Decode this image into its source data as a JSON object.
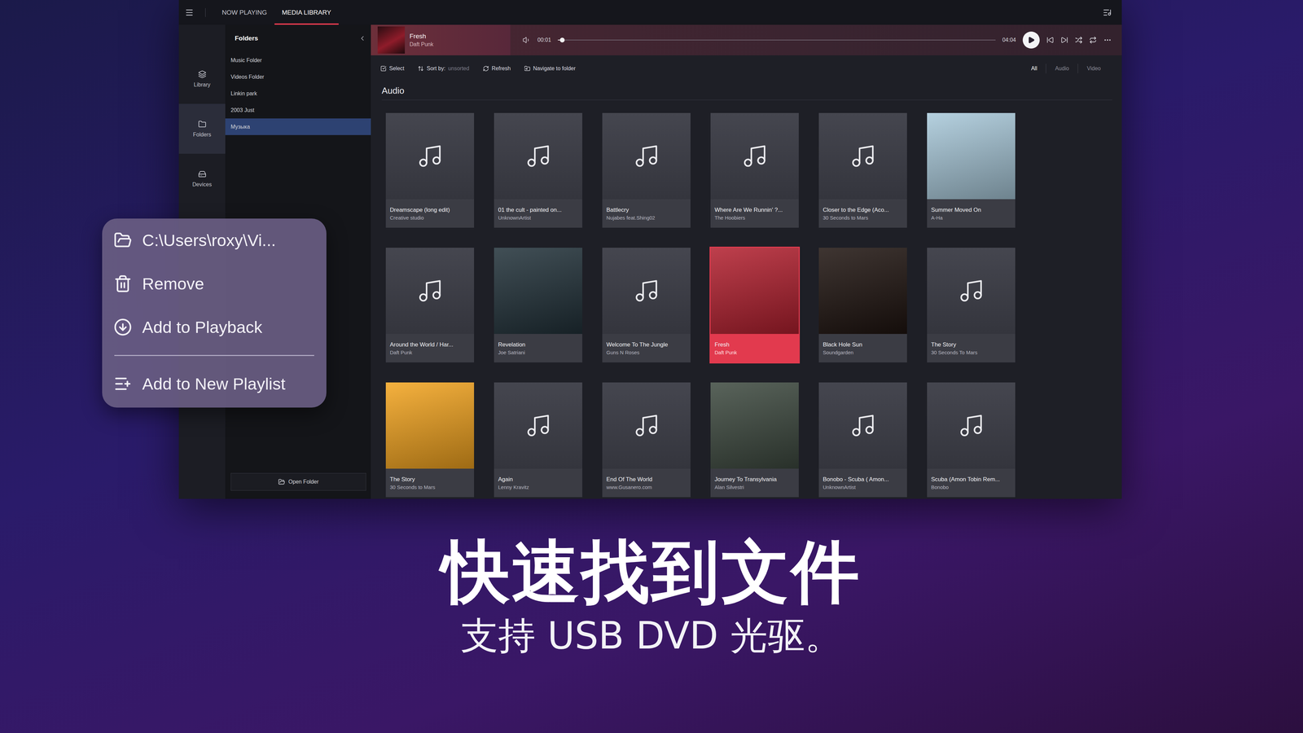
{
  "window": {
    "tabs": [
      {
        "label": "NOW PLAYING",
        "selected": false
      },
      {
        "label": "MEDIA LIBRARY",
        "selected": true
      }
    ]
  },
  "rail": [
    {
      "label": "Library",
      "kind": "library",
      "selected": false
    },
    {
      "label": "Folders",
      "kind": "folders",
      "selected": true
    },
    {
      "label": "Devices",
      "kind": "devices",
      "selected": false
    }
  ],
  "folders_panel": {
    "title": "Folders",
    "items": [
      {
        "label": "Music Folder",
        "selected": false
      },
      {
        "label": "Videos Folder",
        "selected": false
      },
      {
        "label": "Linkin park",
        "selected": false
      },
      {
        "label": "2003 Just",
        "selected": false
      },
      {
        "label": "Музыка",
        "selected": true
      }
    ],
    "button": "Open Folder"
  },
  "player": {
    "title": "Fresh",
    "artist": "Daft Punk",
    "elapsed": "00:01",
    "duration": "04:04",
    "level": 0.01,
    "playing": false
  },
  "toolbar": {
    "actions": [
      {
        "label": "Select",
        "kind": "select",
        "value": ""
      },
      {
        "label": "Sort by:",
        "kind": "sort",
        "value": "unsorted"
      },
      {
        "label": "Refresh",
        "kind": "refresh",
        "value": ""
      },
      {
        "label": "Navigate to folder",
        "kind": "navigate",
        "value": ""
      }
    ],
    "filters": [
      {
        "label": "All",
        "selected": true
      },
      {
        "label": "Audio",
        "selected": false
      },
      {
        "label": "Video",
        "selected": false
      }
    ]
  },
  "section": "Audio",
  "tiles": [
    {
      "title": "Dreamscape (long edit)",
      "artist": "Creative studio",
      "kind": "placeholder",
      "selected": false
    },
    {
      "title": "01 the cult - painted on...",
      "artist": "UnknownArtist",
      "kind": "placeholder",
      "selected": false
    },
    {
      "title": "Battlecry",
      "artist": "Nujabes feat.Shing02",
      "kind": "placeholder",
      "selected": false
    },
    {
      "title": "Where Are We Runnin' ?...",
      "artist": "The Hoobiers",
      "kind": "placeholder",
      "selected": false
    },
    {
      "title": "Closer to the Edge (Aco...",
      "artist": "30 Seconds to Mars",
      "kind": "placeholder",
      "selected": false
    },
    {
      "title": "Summer Moved On",
      "artist": "A-Ha",
      "kind": "art",
      "color": "#a9c9da",
      "selected": false
    },
    {
      "title": "Around the World / Har...",
      "artist": "Daft Punk",
      "kind": "placeholder",
      "selected": false
    },
    {
      "title": "Revelation",
      "artist": "Joe Satriani",
      "kind": "art",
      "color": "#22323a",
      "selected": false
    },
    {
      "title": "Welcome To The Jungle",
      "artist": "Guns N Roses",
      "kind": "placeholder",
      "selected": false
    },
    {
      "title": "Fresh",
      "artist": "Daft Punk",
      "kind": "art",
      "color": "#b3202f",
      "selected": true
    },
    {
      "title": "Black Hole Sun",
      "artist": "Soundgarden",
      "kind": "art",
      "color": "#1f1410",
      "selected": false
    },
    {
      "title": "The Story",
      "artist": "30 Seconds To Mars",
      "kind": "placeholder",
      "selected": false
    },
    {
      "title": "The Story",
      "artist": "30 Seconds to Mars",
      "kind": "art",
      "color": "#f3a41f",
      "selected": false
    },
    {
      "title": "Again",
      "artist": "Lenny Kravitz",
      "kind": "placeholder",
      "selected": false
    },
    {
      "title": "End Of The World",
      "artist": "www.Gusanero.com",
      "kind": "placeholder",
      "selected": false
    },
    {
      "title": "Journey To Transylvania",
      "artist": "Alan Silvestri",
      "kind": "art",
      "color": "#3e4a40",
      "selected": false
    },
    {
      "title": "Bonobo - Scuba ( Amon...",
      "artist": "UnknownArtist",
      "kind": "placeholder",
      "selected": false
    },
    {
      "title": "Scuba (Amon Tobin Rem...",
      "artist": "Bonobo",
      "kind": "placeholder",
      "selected": false
    }
  ],
  "context_menu": {
    "items": [
      {
        "label": "C:\\Users\\roxy\\Vi...",
        "kind": "path",
        "divider_before": false
      },
      {
        "label": "Remove",
        "kind": "remove",
        "divider_before": false
      },
      {
        "label": "Add to Playback",
        "kind": "playback",
        "divider_before": false
      },
      {
        "label": "Add to New Playlist",
        "kind": "playlist",
        "divider_before": true
      }
    ]
  },
  "caption": {
    "title": "快速找到文件",
    "subtitle": "支持 USB DVD 光驱。"
  }
}
